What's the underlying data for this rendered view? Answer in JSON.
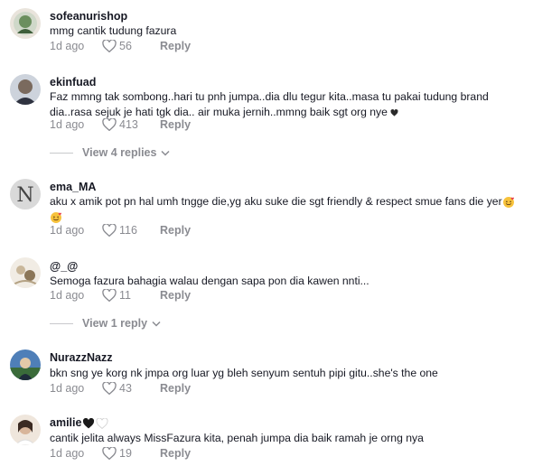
{
  "comments": [
    {
      "username": "sofeanurishop",
      "text": "mmg cantik tudung fazura",
      "time": "1d ago",
      "likes": "56",
      "reply_label": "Reply"
    },
    {
      "username": "ekinfuad",
      "text_line1": "Faz mmng tak sombong..hari tu pnh jumpa..dia dlu tegur kita..masa tu pakai tudung brand",
      "text_line2": "dia..rasa sejuk je hati tgk dia.. air muka jernih..mmng baik sgt org nye",
      "time": "1d ago",
      "likes": "413",
      "reply_label": "Reply",
      "view_replies": "View 4 replies"
    },
    {
      "username": "ema_MA",
      "text": "aku x amik pot pn hal umh tngge die,yg aku suke die sgt friendly & respect smue fans die yer",
      "avatar_letter": "N",
      "time": "1d ago",
      "likes": "116",
      "reply_label": "Reply"
    },
    {
      "username": "@_@",
      "text": "Semoga fazura bahagia walau dengan sapa pon dia kawen nnti...",
      "time": "1d ago",
      "likes": "11",
      "reply_label": "Reply",
      "view_replies": "View 1 reply"
    },
    {
      "username": "NurazzNazz",
      "text": "bkn sng ye korg nk jmpa org luar yg bleh senyum sentuh pipi gitu..she's the one",
      "time": "1d ago",
      "likes": "43",
      "reply_label": "Reply"
    },
    {
      "username": "amilie",
      "text": "cantik jelita always MissFazura kita, penah jumpa dia baik ramah je orng nya",
      "time": "1d ago",
      "likes": "19",
      "reply_label": "Reply"
    }
  ],
  "colors": {
    "primary_text": "#161823",
    "secondary_text": "#8a8b91",
    "divider": "#c8c9cc"
  },
  "icons": [
    "heart-outline-icon",
    "chevron-down-icon",
    "heart-emoji-icon",
    "smiling-face-with-hearts-emoji-icon",
    "black-heart-emoji-icon",
    "white-heart-emoji-icon"
  ]
}
